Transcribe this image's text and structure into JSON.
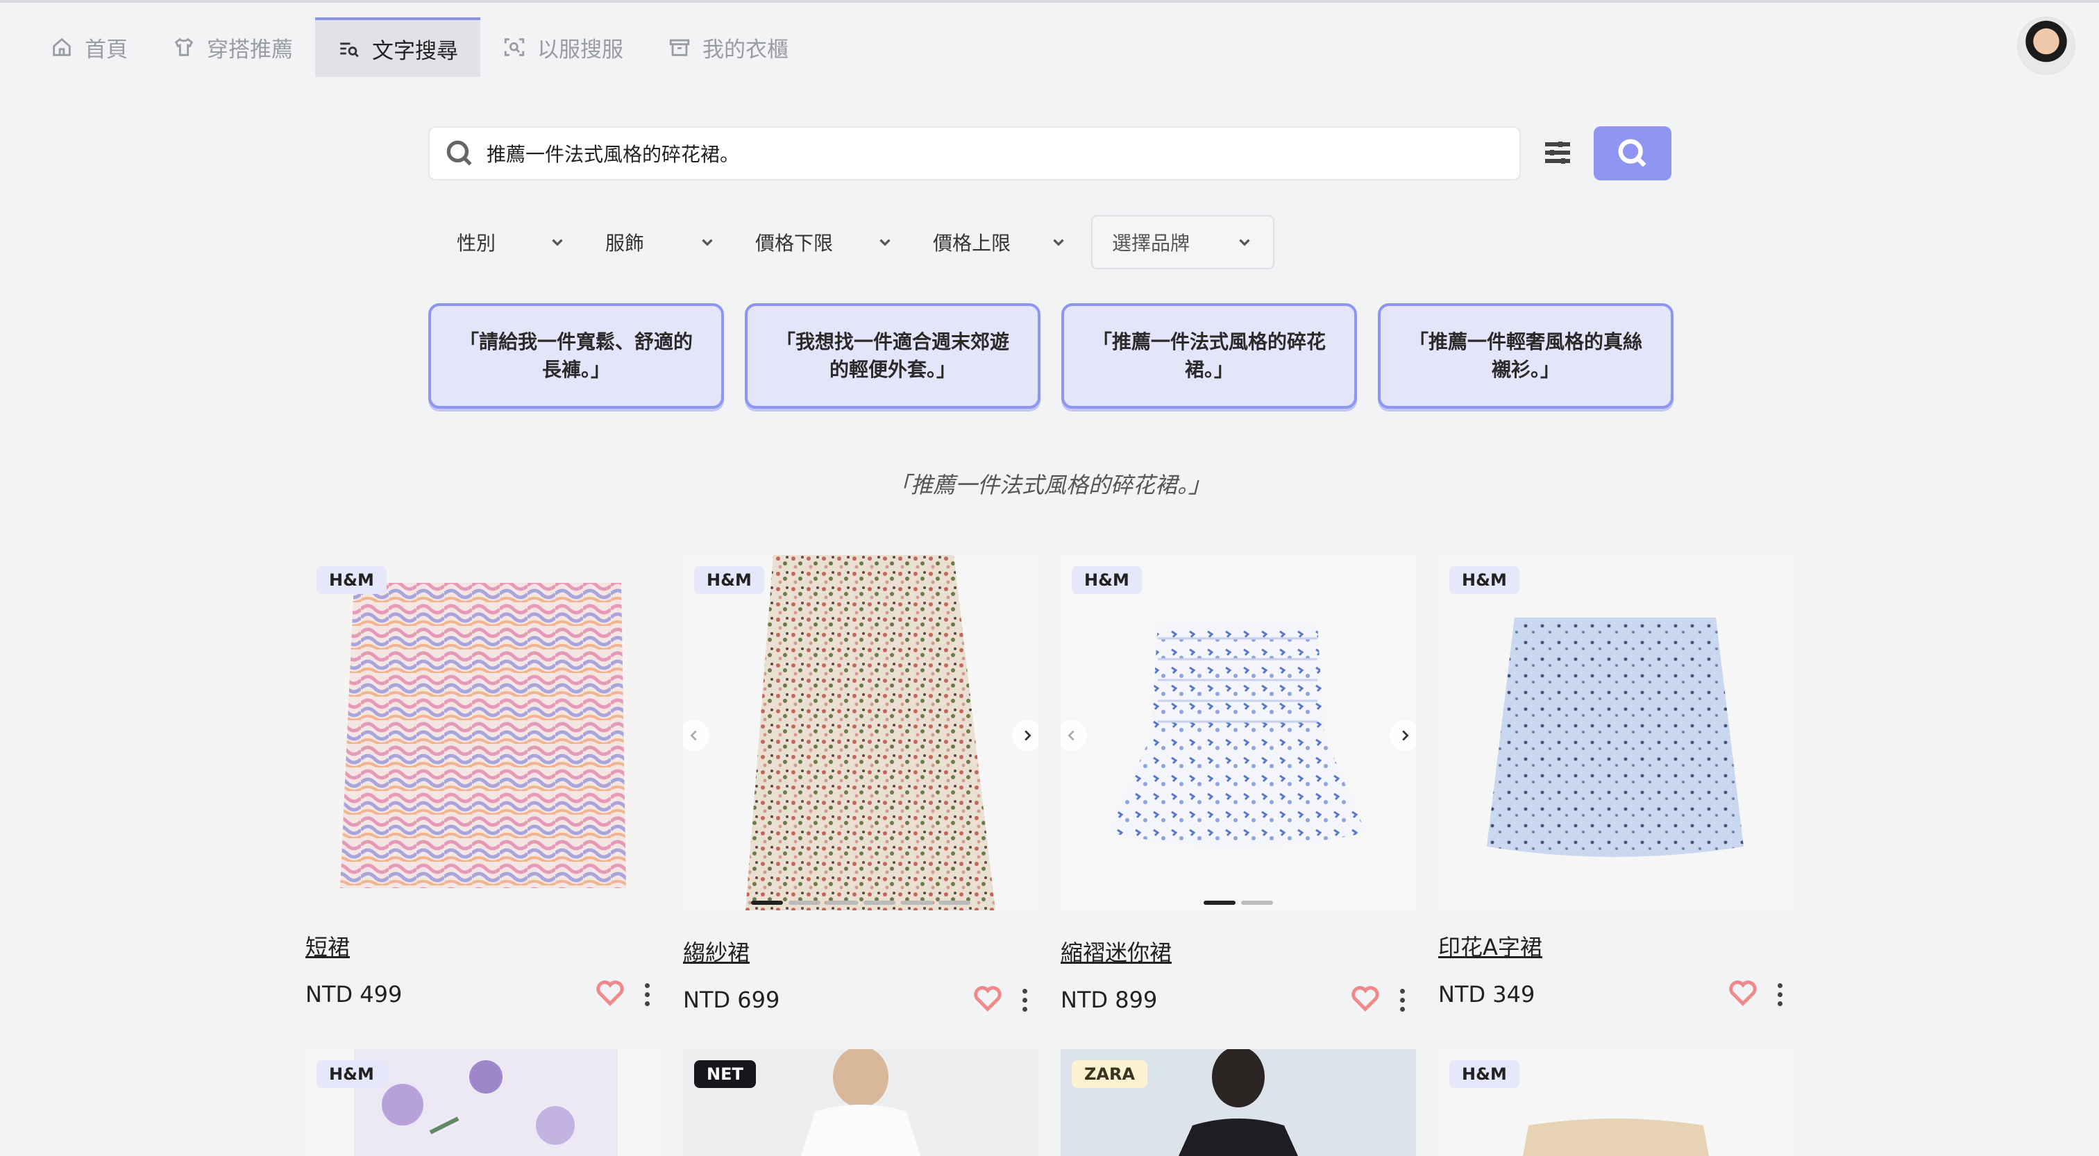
{
  "nav": {
    "items": [
      {
        "label": "首頁",
        "icon": "home-icon"
      },
      {
        "label": "穿搭推薦",
        "icon": "shirt-icon"
      },
      {
        "label": "文字搜尋",
        "icon": "text-search-icon",
        "active": true
      },
      {
        "label": "以服搜服",
        "icon": "image-scan-icon"
      },
      {
        "label": "我的衣櫃",
        "icon": "wardrobe-icon"
      }
    ]
  },
  "search": {
    "value": "推薦一件法式風格的碎花裙。",
    "placeholder": ""
  },
  "filters": {
    "gender": "性別",
    "apparel": "服飾",
    "price_min": "價格下限",
    "price_max": "價格上限",
    "brand": "選擇品牌"
  },
  "suggestions": [
    "「請給我一件寬鬆、舒適的長褲。」",
    "「我想找一件適合週末郊遊的輕便外套。」",
    "「推薦一件法式風格的碎花裙。」",
    "「推薦一件輕奢風格的真絲襯衫。」"
  ],
  "query_echo": "「推薦一件法式風格的碎花裙。」",
  "products": [
    {
      "brand": "H&M",
      "name": "短裙",
      "price": "NTD 499"
    },
    {
      "brand": "H&M",
      "name": "縐紗裙",
      "price": "NTD 699"
    },
    {
      "brand": "H&M",
      "name": "縮褶迷你裙",
      "price": "NTD 899"
    },
    {
      "brand": "H&M",
      "name": "印花A字裙",
      "price": "NTD 349"
    }
  ],
  "products_row2": [
    {
      "brand": "H&M"
    },
    {
      "brand": "NET"
    },
    {
      "brand": "ZARA"
    },
    {
      "brand": "H&M"
    }
  ],
  "colors": {
    "accent": "#8e96f2",
    "suggestion_bg": "#e4e5f9",
    "heart": "#ee8a8a",
    "background": "#f2f3f5"
  }
}
